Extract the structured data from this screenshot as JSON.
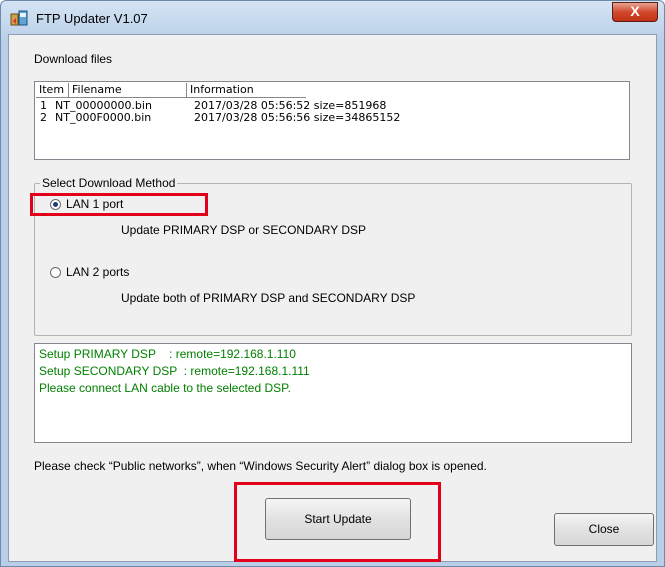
{
  "window": {
    "title": "FTP Updater V1.07",
    "close_glyph": "X"
  },
  "download_files": {
    "label": "Download files",
    "columns": [
      "Item",
      "Filename",
      "Information"
    ],
    "rows": [
      {
        "item": "1",
        "filename": "NT_00000000.bin",
        "info": "2017/03/28 05:56:52 size=851968"
      },
      {
        "item": "2",
        "filename": "NT_000F0000.bin",
        "info": "2017/03/28 05:56:56 size=34865152"
      }
    ]
  },
  "method": {
    "group_label": "Select Download Method",
    "options": [
      {
        "label": "LAN 1 port",
        "description": "Update PRIMARY DSP or SECONDARY DSP",
        "selected": true
      },
      {
        "label": "LAN 2 ports",
        "description": "Update both of PRIMARY DSP and SECONDARY DSP",
        "selected": false
      }
    ]
  },
  "log": {
    "lines": [
      "Setup PRIMARY DSP    : remote=192.168.1.110",
      "Setup SECONDARY DSP  : remote=192.168.1.111",
      "Please connect LAN cable to the selected DSP."
    ],
    "color": "#008000"
  },
  "notice": "Please check “Public networks”, when “Windows Security Alert” dialog box is opened.",
  "buttons": {
    "start_update": "Start Update",
    "close": "Close"
  },
  "highlight_color": "#e3001b"
}
